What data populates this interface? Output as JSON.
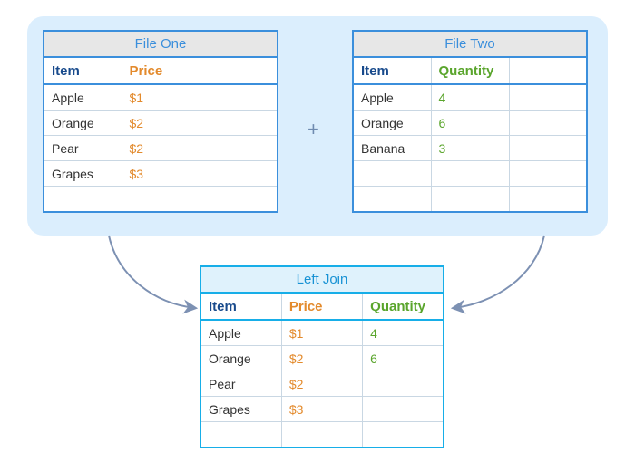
{
  "panel": {
    "plus": "+"
  },
  "file_one": {
    "title": "File One",
    "headers": {
      "item": "Item",
      "price": "Price",
      "blank": ""
    },
    "rows": [
      {
        "item": "Apple",
        "price": "$1"
      },
      {
        "item": "Orange",
        "price": "$2"
      },
      {
        "item": "Pear",
        "price": "$2"
      },
      {
        "item": "Grapes",
        "price": "$3"
      }
    ]
  },
  "file_two": {
    "title": "File Two",
    "headers": {
      "item": "Item",
      "qty": "Quantity",
      "blank": ""
    },
    "rows": [
      {
        "item": "Apple",
        "qty": "4"
      },
      {
        "item": "Orange",
        "qty": "6"
      },
      {
        "item": "Banana",
        "qty": "3"
      }
    ]
  },
  "result": {
    "title": "Left Join",
    "headers": {
      "item": "Item",
      "price": "Price",
      "qty": "Quantity"
    },
    "rows": [
      {
        "item": "Apple",
        "price": "$1",
        "qty": "4"
      },
      {
        "item": "Orange",
        "price": "$2",
        "qty": "6"
      },
      {
        "item": "Pear",
        "price": "$2",
        "qty": ""
      },
      {
        "item": "Grapes",
        "price": "$3",
        "qty": ""
      }
    ]
  }
}
